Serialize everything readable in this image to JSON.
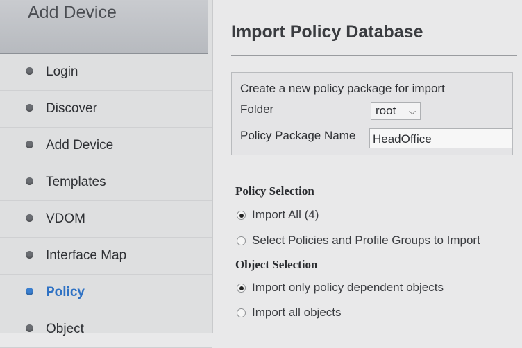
{
  "sidebar": {
    "title": "Add Device",
    "items": [
      {
        "label": "Login",
        "active": false
      },
      {
        "label": "Discover",
        "active": false
      },
      {
        "label": "Add Device",
        "active": false
      },
      {
        "label": "Templates",
        "active": false
      },
      {
        "label": "VDOM",
        "active": false
      },
      {
        "label": "Interface Map",
        "active": false
      },
      {
        "label": "Policy",
        "active": true
      },
      {
        "label": "Object",
        "active": false
      }
    ]
  },
  "main": {
    "title": "Import Policy Database",
    "panel": {
      "heading": "Create a new policy package for import",
      "folder_label": "Folder",
      "folder_value": "root",
      "package_label": "Policy Package Name",
      "package_value": "HeadOffice"
    },
    "policy_selection": {
      "heading": "Policy Selection",
      "options": [
        {
          "label": "Import All (4)",
          "selected": true
        },
        {
          "label": "Select Policies and Profile Groups to Import",
          "selected": false
        }
      ]
    },
    "object_selection": {
      "heading": "Object Selection",
      "options": [
        {
          "label": "Import only policy dependent objects",
          "selected": true
        },
        {
          "label": "Import all objects",
          "selected": false
        }
      ]
    }
  },
  "colors": {
    "accent": "#2f72c4",
    "sidebar_bg": "#dedfe0",
    "page_bg": "#e9e9ea"
  }
}
